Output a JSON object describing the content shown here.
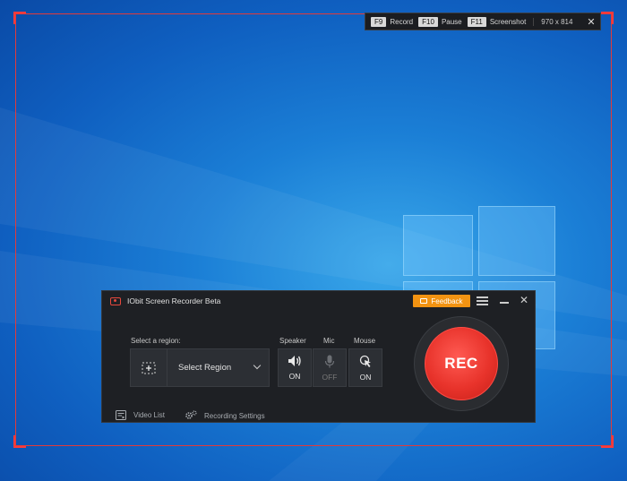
{
  "hotkeys": {
    "items": [
      {
        "key": "F9",
        "label": "Record"
      },
      {
        "key": "F10",
        "label": "Pause"
      },
      {
        "key": "F11",
        "label": "Screenshot"
      }
    ],
    "dimensions": "970 x 814",
    "close_label": "✕"
  },
  "recorder": {
    "title": "IObit Screen Recorder Beta",
    "feedback_label": "Feedback",
    "region_label": "Select a region:",
    "region_value": "Select Region",
    "devices": {
      "speaker": {
        "label": "Speaker",
        "state": "ON"
      },
      "mic": {
        "label": "Mic",
        "state": "OFF"
      },
      "mouse": {
        "label": "Mouse",
        "state": "ON"
      }
    },
    "rec_label": "REC",
    "video_list_label": "Video List",
    "recording_settings_label": "Recording Settings"
  },
  "colors": {
    "accent_feedback": "#f29312",
    "rec_red": "#e8332b",
    "frame_red": "#e23a3a",
    "window_bg": "#1e2024",
    "desktop_blue": "#1b7fd6"
  },
  "icons": {
    "app": "recorder-logo-icon",
    "feedback": "chat-icon",
    "menu": "hamburger-icon",
    "minimize": "minimize-icon",
    "close": "close-icon",
    "region": "crosshair-icon",
    "dropdown": "chevron-down-icon",
    "speaker": "speaker-icon",
    "mic": "microphone-icon",
    "mouse": "mouse-click-icon",
    "video_list": "video-list-icon",
    "settings": "gears-icon"
  }
}
